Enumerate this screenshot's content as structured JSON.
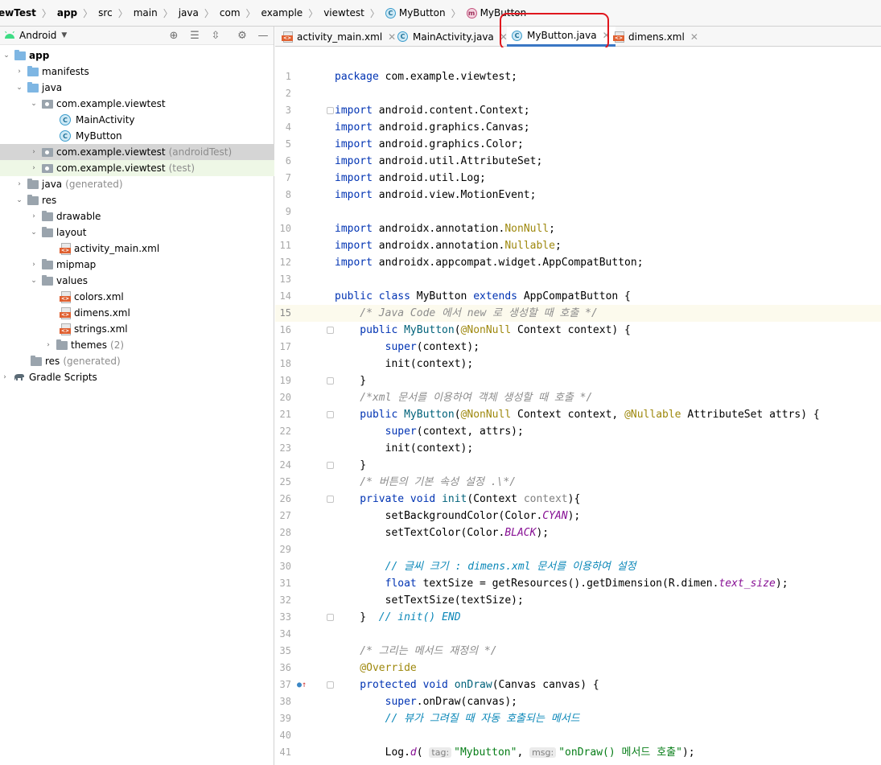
{
  "breadcrumb": {
    "items": [
      "ewTest",
      "app",
      "src",
      "main",
      "java",
      "com",
      "example",
      "viewtest",
      "MyButton",
      "MyButton"
    ],
    "class_icon": "C",
    "method_icon": "m"
  },
  "project_panel": {
    "view_label": "Android",
    "tree": [
      {
        "label": "app",
        "suffix": ""
      },
      {
        "label": "manifests",
        "suffix": ""
      },
      {
        "label": "java",
        "suffix": ""
      },
      {
        "label": "com.example.viewtest",
        "suffix": ""
      },
      {
        "label": "MainActivity",
        "suffix": ""
      },
      {
        "label": "MyButton",
        "suffix": ""
      },
      {
        "label": "com.example.viewtest",
        "suffix": "(androidTest)"
      },
      {
        "label": "com.example.viewtest",
        "suffix": "(test)"
      },
      {
        "label": "java",
        "suffix": "(generated)"
      },
      {
        "label": "res",
        "suffix": ""
      },
      {
        "label": "drawable",
        "suffix": ""
      },
      {
        "label": "layout",
        "suffix": ""
      },
      {
        "label": "activity_main.xml",
        "suffix": ""
      },
      {
        "label": "mipmap",
        "suffix": ""
      },
      {
        "label": "values",
        "suffix": ""
      },
      {
        "label": "colors.xml",
        "suffix": ""
      },
      {
        "label": "dimens.xml",
        "suffix": ""
      },
      {
        "label": "strings.xml",
        "suffix": ""
      },
      {
        "label": "themes",
        "suffix": "(2)"
      },
      {
        "label": "res",
        "suffix": "(generated)"
      },
      {
        "label": "Gradle Scripts",
        "suffix": ""
      }
    ]
  },
  "tabs": [
    {
      "label": "activity_main.xml"
    },
    {
      "label": "MainActivity.java"
    },
    {
      "label": "MyButton.java"
    },
    {
      "label": "dimens.xml"
    }
  ],
  "code": {
    "line_numbers": [
      "1",
      "2",
      "3",
      "4",
      "5",
      "6",
      "7",
      "8",
      "9",
      "10",
      "11",
      "12",
      "13",
      "14",
      "15",
      "16",
      "17",
      "18",
      "19",
      "20",
      "21",
      "22",
      "23",
      "24",
      "25",
      "26",
      "27",
      "28",
      "29",
      "30",
      "31",
      "32",
      "33",
      "34",
      "35",
      "36",
      "37",
      "38",
      "39",
      "40",
      "41"
    ],
    "l1": {
      "a": "package",
      "b": " com.example.viewtest;"
    },
    "l3": {
      "a": "import",
      "b": " android.content.Context;"
    },
    "l4": {
      "a": "import",
      "b": " android.graphics.Canvas;"
    },
    "l5": {
      "a": "import",
      "b": " android.graphics.Color;"
    },
    "l6": {
      "a": "import",
      "b": " android.util.AttributeSet;"
    },
    "l7": {
      "a": "import",
      "b": " android.util.Log;"
    },
    "l8": {
      "a": "import",
      "b": " android.view.MotionEvent;"
    },
    "l10": {
      "a": "import",
      "b": " androidx.annotation.",
      "c": "NonNull",
      "d": ";"
    },
    "l11": {
      "a": "import",
      "b": " androidx.annotation.",
      "c": "Nullable",
      "d": ";"
    },
    "l12": {
      "a": "import",
      "b": " androidx.appcompat.widget.AppCompatButton;"
    },
    "l14": {
      "a": "public class ",
      "b": "MyButton ",
      "c": "extends ",
      "d": "AppCompatButton {"
    },
    "l15": {
      "a": "    /* Java Code 에서 new 로 생성할 때 호출 */"
    },
    "l16": {
      "a": "    public ",
      "b": "MyButton",
      "c": "(",
      "d": "@NonNull",
      "e": " Context context) {"
    },
    "l17": {
      "a": "        super",
      "b": "(context);"
    },
    "l18": {
      "a": "        init(context);"
    },
    "l19": {
      "a": "    }"
    },
    "l20": {
      "a": "    /*xml 문서를 이용하여 객체 생성할 때 호출 */"
    },
    "l21": {
      "a": "    public ",
      "b": "MyButton",
      "c": "(",
      "d": "@NonNull",
      "e": " Context context, ",
      "f": "@Nullable",
      "g": " AttributeSet attrs) {"
    },
    "l22": {
      "a": "        super",
      "b": "(context, attrs);"
    },
    "l23": {
      "a": "        init(context);"
    },
    "l24": {
      "a": "    }"
    },
    "l25": {
      "a": "    /* 버튼의 기본 속성 설정 .\\*/"
    },
    "l26": {
      "a": "    private void ",
      "b": "init",
      "c": "(Context ",
      "d": "context",
      "e": "){"
    },
    "l27": {
      "a": "        setBackgroundColor(Color.",
      "b": "CYAN",
      "c": ");"
    },
    "l28": {
      "a": "        setTextColor(Color.",
      "b": "BLACK",
      "c": ");"
    },
    "l30": {
      "a": "        // 글씨 크기 : dimens.xml 문서를 이용하여 설정"
    },
    "l31": {
      "a": "        float ",
      "b": "textSize = getResources().getDimension(R.dimen.",
      "c": "text_size",
      "d": ");"
    },
    "l32": {
      "a": "        setTextSize(textSize);"
    },
    "l33": {
      "a": "    }  ",
      "b": "// init() END"
    },
    "l35": {
      "a": "    /* 그리는 메서드 재정의 */"
    },
    "l36": {
      "a": "    @Override"
    },
    "l37": {
      "a": "    protected void ",
      "b": "onDraw",
      "c": "(Canvas canvas) {"
    },
    "l38": {
      "a": "        super",
      "b": ".onDraw(canvas);"
    },
    "l39": {
      "a": "        // 뷰가 그려질 때 자동 호출되는 메서드"
    },
    "l41": {
      "a": "        Log.",
      "b": "d",
      "c": "( ",
      "h1": "tag:",
      "d": "\"Mybutton\"",
      "e": ", ",
      "h2": "msg:",
      "f": "\"onDraw() 메서드 호출\"",
      "g": ");"
    }
  }
}
